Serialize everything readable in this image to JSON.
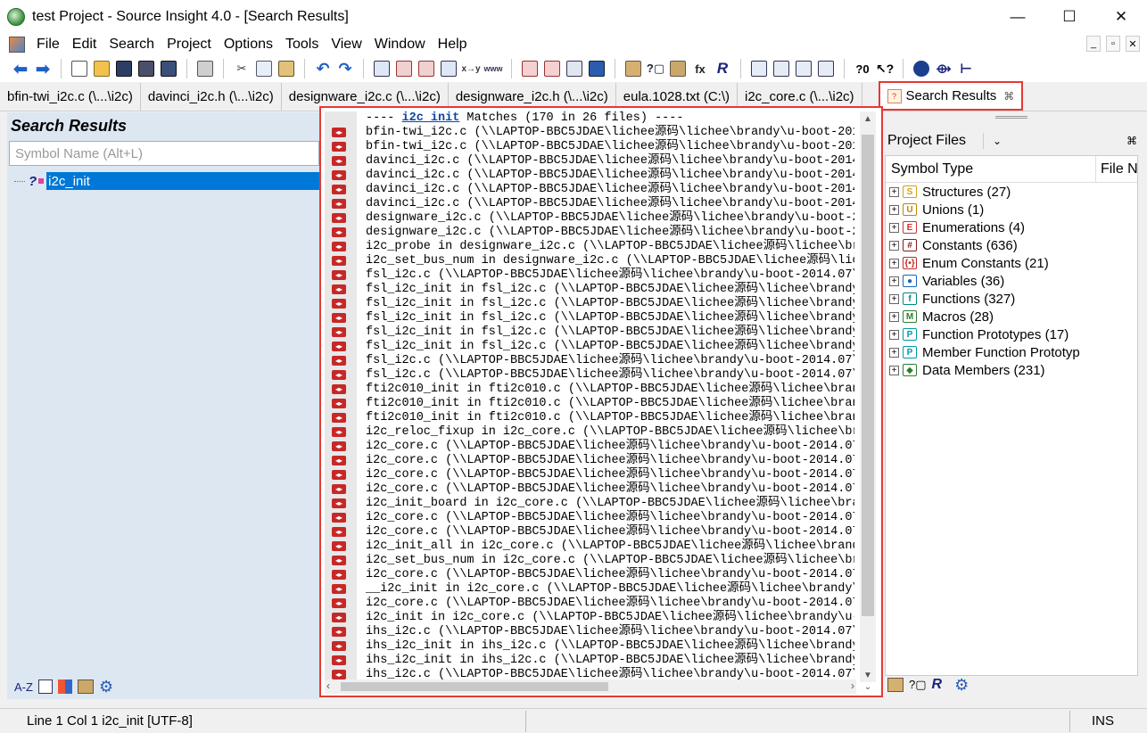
{
  "window": {
    "title": "test Project - Source Insight 4.0 - [Search Results]",
    "minimize": "—",
    "maximize": "☐",
    "close": "✕"
  },
  "menu": [
    "File",
    "Edit",
    "Search",
    "Project",
    "Options",
    "Tools",
    "View",
    "Window",
    "Help"
  ],
  "tabs": [
    {
      "label": "bfin-twi_i2c.c (\\...\\i2c)"
    },
    {
      "label": "davinci_i2c.h (\\...\\i2c)"
    },
    {
      "label": "designware_i2c.c (\\...\\i2c)"
    },
    {
      "label": "designware_i2c.h (\\...\\i2c)"
    },
    {
      "label": "eula.1028.txt (C:\\)"
    },
    {
      "label": "i2c_core.c (\\...\\i2c)"
    }
  ],
  "active_tab": {
    "label": "Search Results",
    "close": "⌘"
  },
  "left_panel": {
    "title": "Search Results",
    "search_placeholder": "Symbol Name (Alt+L)",
    "tree_item": "i2c_init",
    "bottom_icons": [
      "A-Z",
      "list-icon",
      "tree-icon",
      "book-icon",
      "gear-icon"
    ]
  },
  "search_results": {
    "header_prefix": "---- ",
    "header_keyword": "i2c_init",
    "header_suffix": " Matches (170 in 26 files) ----",
    "lines": [
      "bfin-twi_i2c.c (\\\\LAPTOP-BBC5JDAE\\lichee源码\\lichee\\brandy\\u-boot-201",
      "bfin-twi_i2c.c (\\\\LAPTOP-BBC5JDAE\\lichee源码\\lichee\\brandy\\u-boot-201",
      "davinci_i2c.c (\\\\LAPTOP-BBC5JDAE\\lichee源码\\lichee\\brandy\\u-boot-2014",
      "davinci_i2c.c (\\\\LAPTOP-BBC5JDAE\\lichee源码\\lichee\\brandy\\u-boot-2014",
      "davinci_i2c.c (\\\\LAPTOP-BBC5JDAE\\lichee源码\\lichee\\brandy\\u-boot-2014",
      "davinci_i2c.c (\\\\LAPTOP-BBC5JDAE\\lichee源码\\lichee\\brandy\\u-boot-2014",
      "designware_i2c.c (\\\\LAPTOP-BBC5JDAE\\lichee源码\\lichee\\brandy\\u-boot-2",
      "designware_i2c.c (\\\\LAPTOP-BBC5JDAE\\lichee源码\\lichee\\brandy\\u-boot-2",
      "i2c_probe in designware_i2c.c (\\\\LAPTOP-BBC5JDAE\\lichee源码\\lichee\\br",
      "i2c_set_bus_num in designware_i2c.c (\\\\LAPTOP-BBC5JDAE\\lichee源码\\lic",
      "fsl_i2c.c (\\\\LAPTOP-BBC5JDAE\\lichee源码\\lichee\\brandy\\u-boot-2014.07\\",
      "fsl_i2c_init in fsl_i2c.c (\\\\LAPTOP-BBC5JDAE\\lichee源码\\lichee\\brandy",
      "fsl_i2c_init in fsl_i2c.c (\\\\LAPTOP-BBC5JDAE\\lichee源码\\lichee\\brandy",
      "fsl_i2c_init in fsl_i2c.c (\\\\LAPTOP-BBC5JDAE\\lichee源码\\lichee\\brandy",
      "fsl_i2c_init in fsl_i2c.c (\\\\LAPTOP-BBC5JDAE\\lichee源码\\lichee\\brandy",
      "fsl_i2c_init in fsl_i2c.c (\\\\LAPTOP-BBC5JDAE\\lichee源码\\lichee\\brandy",
      "fsl_i2c.c (\\\\LAPTOP-BBC5JDAE\\lichee源码\\lichee\\brandy\\u-boot-2014.07\\",
      "fsl_i2c.c (\\\\LAPTOP-BBC5JDAE\\lichee源码\\lichee\\brandy\\u-boot-2014.07\\",
      "fti2c010_init in fti2c010.c (\\\\LAPTOP-BBC5JDAE\\lichee源码\\lichee\\bran",
      "fti2c010_init in fti2c010.c (\\\\LAPTOP-BBC5JDAE\\lichee源码\\lichee\\bran",
      "fti2c010_init in fti2c010.c (\\\\LAPTOP-BBC5JDAE\\lichee源码\\lichee\\bran",
      "i2c_reloc_fixup in i2c_core.c (\\\\LAPTOP-BBC5JDAE\\lichee源码\\lichee\\br",
      "i2c_core.c (\\\\LAPTOP-BBC5JDAE\\lichee源码\\lichee\\brandy\\u-boot-2014.07",
      "i2c_core.c (\\\\LAPTOP-BBC5JDAE\\lichee源码\\lichee\\brandy\\u-boot-2014.07",
      "i2c_core.c (\\\\LAPTOP-BBC5JDAE\\lichee源码\\lichee\\brandy\\u-boot-2014.07",
      "i2c_core.c (\\\\LAPTOP-BBC5JDAE\\lichee源码\\lichee\\brandy\\u-boot-2014.07",
      "i2c_init_board in i2c_core.c (\\\\LAPTOP-BBC5JDAE\\lichee源码\\lichee\\bra",
      "i2c_core.c (\\\\LAPTOP-BBC5JDAE\\lichee源码\\lichee\\brandy\\u-boot-2014.07",
      "i2c_core.c (\\\\LAPTOP-BBC5JDAE\\lichee源码\\lichee\\brandy\\u-boot-2014.07",
      "i2c_init_all in i2c_core.c (\\\\LAPTOP-BBC5JDAE\\lichee源码\\lichee\\brand",
      "i2c_set_bus_num in i2c_core.c (\\\\LAPTOP-BBC5JDAE\\lichee源码\\lichee\\br",
      "i2c_core.c (\\\\LAPTOP-BBC5JDAE\\lichee源码\\lichee\\brandy\\u-boot-2014.07",
      "__i2c_init in i2c_core.c (\\\\LAPTOP-BBC5JDAE\\lichee源码\\lichee\\brandy\\",
      "i2c_core.c (\\\\LAPTOP-BBC5JDAE\\lichee源码\\lichee\\brandy\\u-boot-2014.07",
      "i2c_init in i2c_core.c (\\\\LAPTOP-BBC5JDAE\\lichee源码\\lichee\\brandy\\u-",
      "ihs_i2c.c (\\\\LAPTOP-BBC5JDAE\\lichee源码\\lichee\\brandy\\u-boot-2014.07\\",
      "ihs_i2c_init in ihs_i2c.c (\\\\LAPTOP-BBC5JDAE\\lichee源码\\lichee\\brandy",
      "ihs_i2c_init in ihs_i2c.c (\\\\LAPTOP-BBC5JDAE\\lichee源码\\lichee\\brandy",
      "ihs_i2c.c (\\\\LAPTOP-BBC5JDAE\\lichee源码\\lichee\\brandy\\u-boot-2014.07\\"
    ]
  },
  "right_panel": {
    "header": "Project Files",
    "col_symbol_type": "Symbol Type",
    "col_file": "File N",
    "symbol_types": [
      {
        "label": "Structures (27)",
        "icon": "structure-icon",
        "color": "#d4a017",
        "glyph": "S"
      },
      {
        "label": "Unions (1)",
        "icon": "union-icon",
        "color": "#b8860b",
        "glyph": "U"
      },
      {
        "label": "Enumerations (4)",
        "icon": "enum-icon",
        "color": "#d32f2f",
        "glyph": "E"
      },
      {
        "label": "Constants (636)",
        "icon": "constant-icon",
        "color": "#8b1a1a",
        "glyph": "#"
      },
      {
        "label": "Enum Constants (21)",
        "icon": "enum-constant-icon",
        "color": "#c62828",
        "glyph": "{•}"
      },
      {
        "label": "Variables (36)",
        "icon": "variable-icon",
        "color": "#1565c0",
        "glyph": "●"
      },
      {
        "label": "Functions (327)",
        "icon": "function-icon",
        "color": "#00897b",
        "glyph": "f"
      },
      {
        "label": "Macros (28)",
        "icon": "macro-icon",
        "color": "#2e7d32",
        "glyph": "M"
      },
      {
        "label": "Function Prototypes (17)",
        "icon": "function-prototype-icon",
        "color": "#0097a7",
        "glyph": "P"
      },
      {
        "label": "Member Function Prototyp",
        "icon": "member-function-prototype-icon",
        "color": "#0097a7",
        "glyph": "P"
      },
      {
        "label": "Data Members (231)",
        "icon": "data-member-icon",
        "color": "#2e7d32",
        "glyph": "◆"
      }
    ]
  },
  "status": {
    "position": "Line 1  Col 1   i2c_init [UTF-8]",
    "mode": "INS"
  },
  "colors": {
    "highlight_border": "#e53935",
    "selection": "#0078d7",
    "left_panel_bg": "#dce7f2"
  }
}
